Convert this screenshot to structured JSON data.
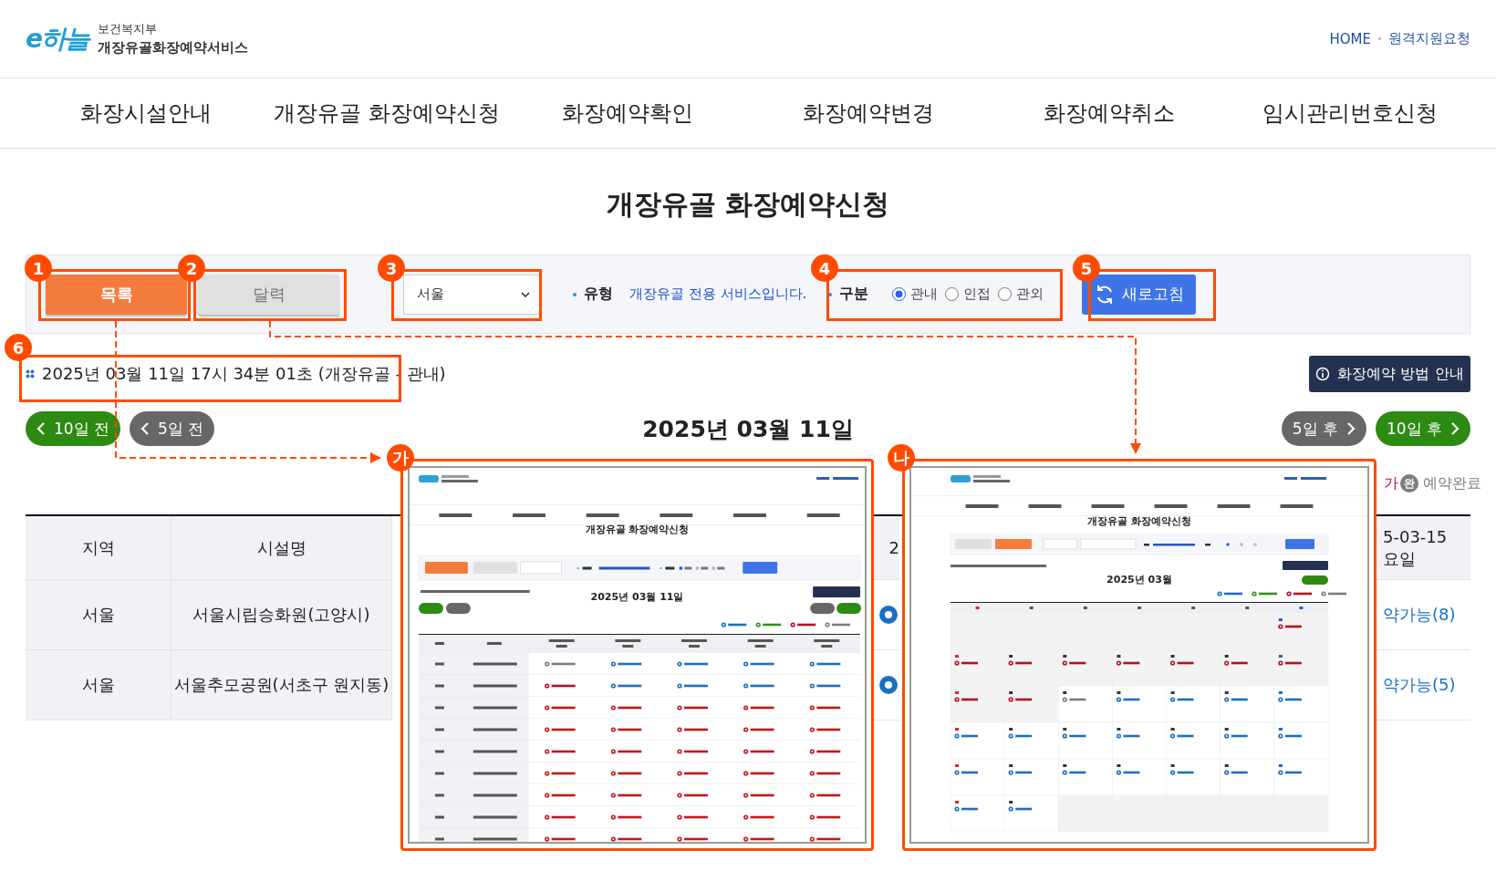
{
  "header": {
    "logo": "e하늘",
    "org": "보건복지부",
    "service": "개장유골화장예약서비스",
    "links": [
      "HOME",
      "원격지원요청"
    ]
  },
  "nav": [
    "화장시설안내",
    "개장유골 화장예약신청",
    "화장예약확인",
    "화장예약변경",
    "화장예약취소",
    "임시관리번호신청"
  ],
  "page_title": "개장유골 화장예약신청",
  "toolbar": {
    "view_buttons": [
      {
        "label": "목록",
        "selected": true
      },
      {
        "label": "달력",
        "selected": false
      }
    ],
    "select": "서울",
    "type_label": "유형",
    "type_value": "개장유골 전용 서비스입니다.",
    "area_label": "구분",
    "area_options": [
      {
        "label": "관내",
        "selected": true
      },
      {
        "label": "인접",
        "selected": false
      },
      {
        "label": "관외",
        "selected": false
      }
    ],
    "refresh": "새로고침"
  },
  "timestamp": "2025년 03월 11일 17시 34분 01초 (개장유골 - 관내)",
  "guide_button": "화장예약 방법 안내",
  "date_nav": {
    "back": [
      {
        "label": "10일 전",
        "kind": "far"
      },
      {
        "label": "5일 전",
        "kind": "near"
      }
    ],
    "current": "2025년 03월 11일",
    "forward": [
      {
        "label": "5일 후",
        "kind": "near"
      },
      {
        "label": "10일 후",
        "kind": "far"
      }
    ]
  },
  "legend": [
    {
      "kind": "text",
      "color": "#b3121f",
      "text": "가"
    },
    {
      "kind": "icon",
      "color": "#7d7d7d",
      "mark": "완",
      "text": "예약완료"
    }
  ],
  "table": {
    "columns": [
      {
        "lines": [
          "지역"
        ]
      },
      {
        "lines": [
          "시설명"
        ]
      },
      {
        "lines": [
          "2"
        ]
      },
      {
        "lines": [
          "5-03-15",
          "요일"
        ]
      }
    ],
    "rows": [
      {
        "region": "서울",
        "facility": "서울시립승화원(고양시)",
        "cells": [
          {
            "kind": "icon"
          },
          {
            "kind": "text",
            "text": "약가능(8)"
          }
        ]
      },
      {
        "region": "서울",
        "facility": "서울추모공원(서초구 원지동)",
        "cells": [
          {
            "kind": "icon"
          },
          {
            "kind": "text",
            "text": "약가능(5)"
          }
        ]
      }
    ]
  },
  "callouts": [
    "1",
    "2",
    "3",
    "4",
    "5",
    "6"
  ],
  "screenshots": [
    {
      "badge": "가",
      "kind": "list",
      "title": "개장유골 화장예약신청",
      "heading": "2025년 03월 11일"
    },
    {
      "badge": "나",
      "kind": "calendar",
      "title": "개장유골 화장예약신청",
      "heading": "2025년 03월"
    }
  ]
}
